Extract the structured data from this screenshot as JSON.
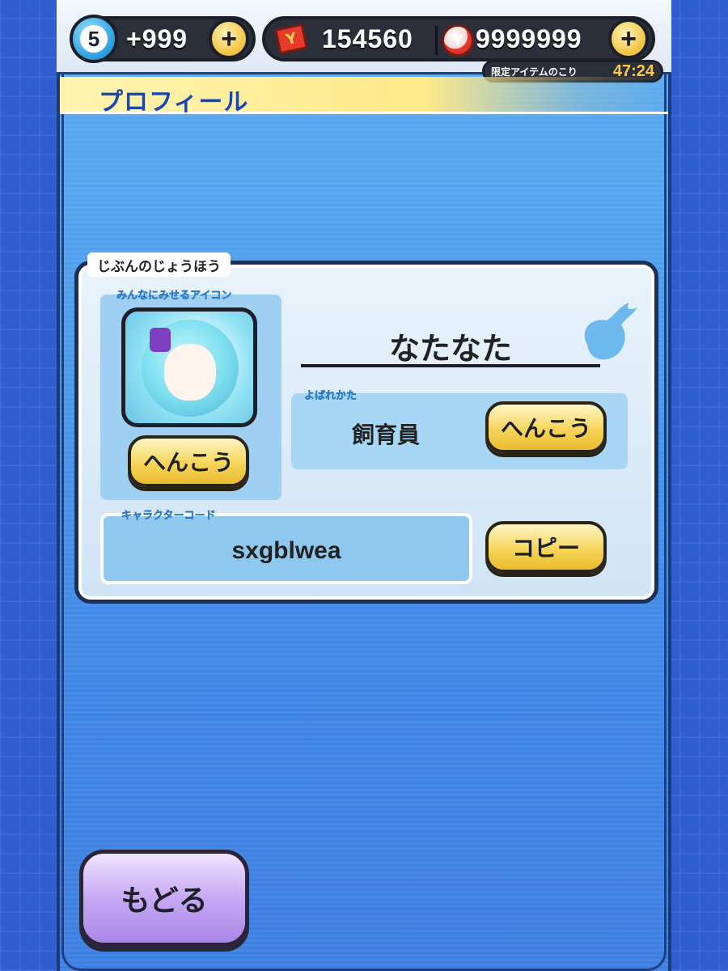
{
  "topbar": {
    "soul_level": "5",
    "soul_count": "+999",
    "tickets": "154560",
    "coins": "9999999",
    "timer_label": "限定アイテムのこり",
    "timer_value": "47:24"
  },
  "page": {
    "title": "プロフィール"
  },
  "profile": {
    "section_label": "じぶんのじょうほう",
    "icon_label": "みんなにみせるアイコン",
    "icon_change_label": "へんこう",
    "name": "なたなた",
    "title_label": "よばれかた",
    "title_value": "飼育員",
    "title_change_label": "へんこう",
    "code_label": "キャラクターコード",
    "code_value": "sxgblwea",
    "copy_label": "コピー"
  },
  "footer": {
    "back_label": "もどる"
  },
  "colors": {
    "accent_yellow": "#f6d55a",
    "back_purple": "#c7a8f4",
    "panel_blue": "#a8d7f5",
    "frame_dark": "#1b2f57"
  },
  "icons": [
    "soul-icon",
    "ticket-icon",
    "coin-icon",
    "plus-icon",
    "watch-icon",
    "avatar-image"
  ]
}
